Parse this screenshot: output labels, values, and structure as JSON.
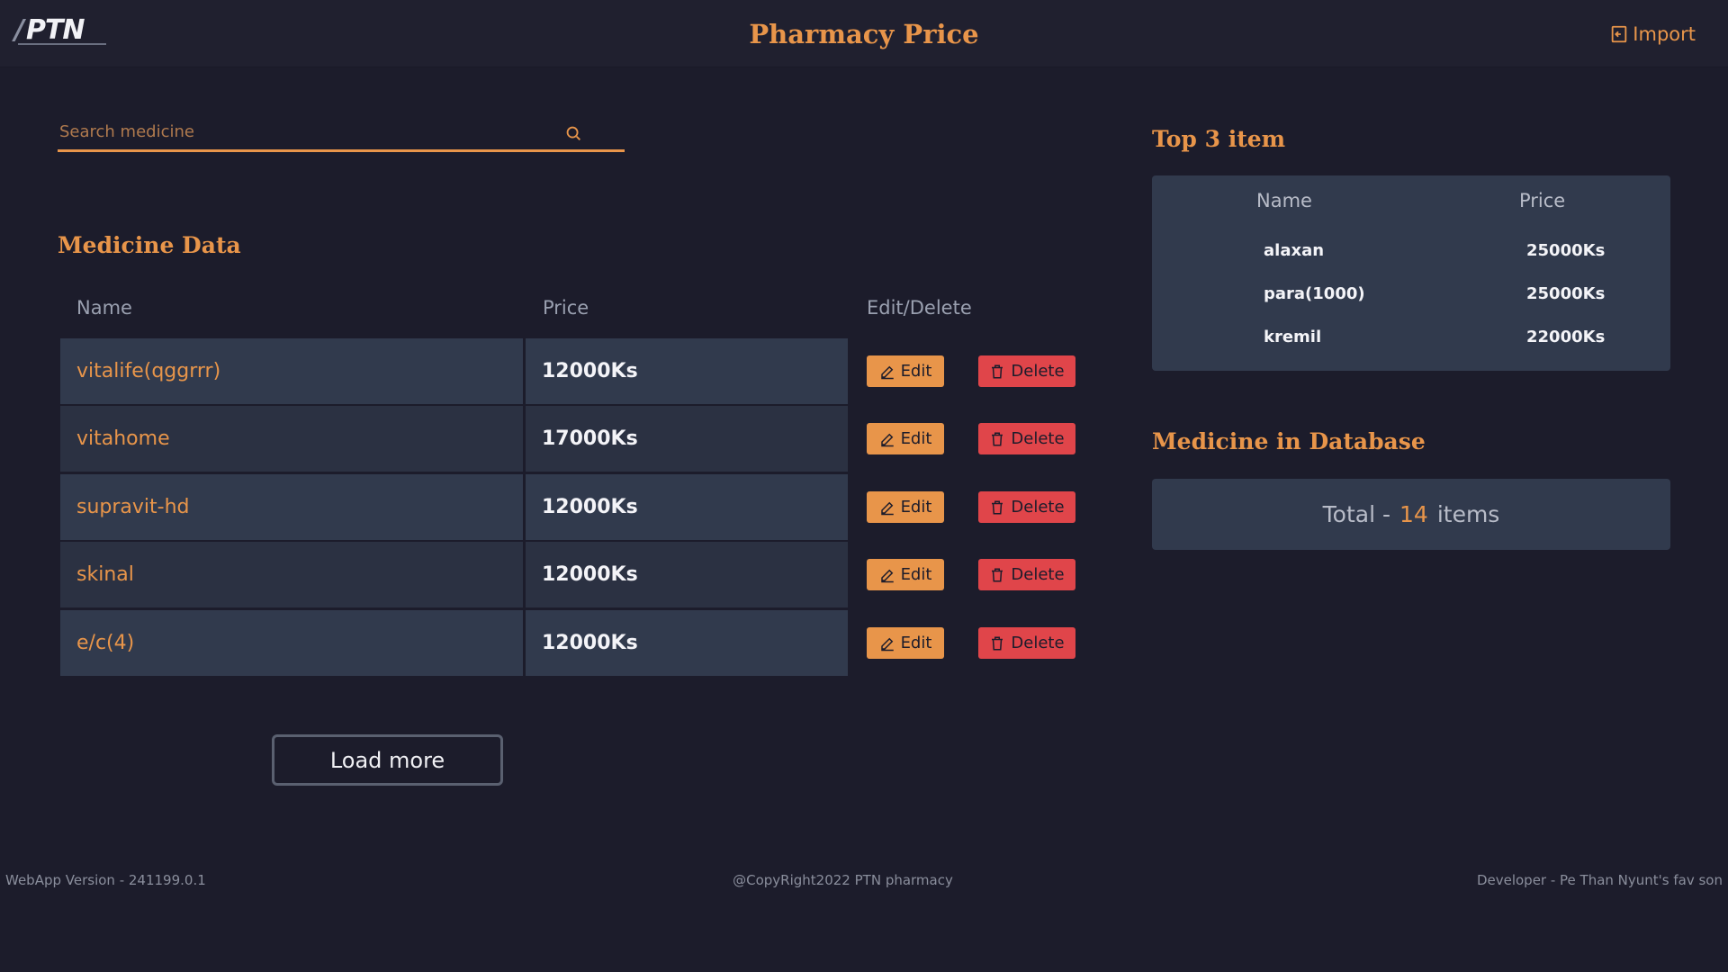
{
  "header": {
    "logo_text": "PTN",
    "title": "Pharmacy Price",
    "import_label": "Import"
  },
  "search": {
    "placeholder": "Search medicine",
    "value": ""
  },
  "medicine": {
    "title": "Medicine Data",
    "columns": [
      "Name",
      "Price",
      "Edit/Delete"
    ],
    "rows": [
      {
        "name": "vitalife(qggrrr)",
        "price": "12000Ks"
      },
      {
        "name": "vitahome",
        "price": "17000Ks"
      },
      {
        "name": "supravit-hd",
        "price": "12000Ks"
      },
      {
        "name": "skinal",
        "price": "12000Ks"
      },
      {
        "name": "e/c(4)",
        "price": "12000Ks"
      }
    ],
    "edit_label": "Edit",
    "delete_label": "Delete",
    "load_more_label": "Load more"
  },
  "top3": {
    "title": "Top 3 item",
    "columns": [
      "Name",
      "Price"
    ],
    "rows": [
      {
        "name": "alaxan",
        "price": "25000Ks"
      },
      {
        "name": "para(1000)",
        "price": "25000Ks"
      },
      {
        "name": "kremil",
        "price": "22000Ks"
      }
    ]
  },
  "database": {
    "title": "Medicine in Database",
    "total_prefix": "Total -",
    "count": "14",
    "suffix": "items"
  },
  "footer": {
    "version": "WebApp Version - 241199.0.1",
    "copyright": "@CopyRight2022 PTN pharmacy",
    "developer": "Developer - Pe Than Nyunt's fav son"
  },
  "colors": {
    "accent": "#e8954a",
    "danger": "#e0454a",
    "background": "#1c1c2b",
    "panel": "#313a4d"
  }
}
